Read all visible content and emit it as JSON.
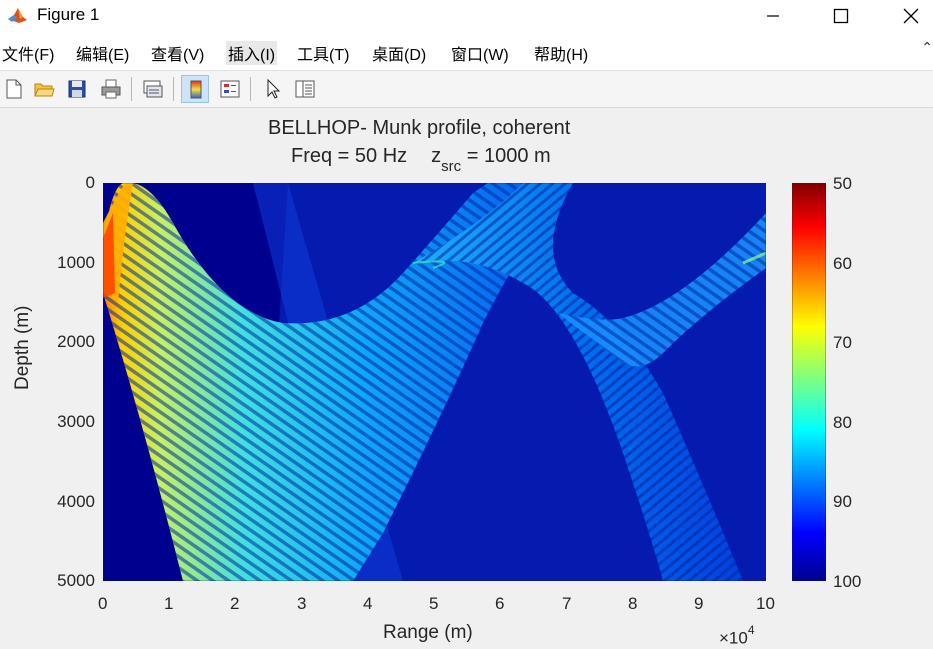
{
  "window": {
    "title": "Figure 1"
  },
  "menu": [
    "文件(F)",
    "编辑(E)",
    "查看(V)",
    "插入(I)",
    "工具(T)",
    "桌面(D)",
    "窗口(W)",
    "帮助(H)"
  ],
  "menu_overflow": "⌃",
  "toolbar": {
    "buttons": [
      "new-figure",
      "open-file",
      "save-figure",
      "print-figure",
      "link-plot",
      "toggle-plot-tools",
      "insert-legend",
      "edit-plot",
      "open-property-inspector"
    ]
  },
  "plot": {
    "title_line1": "BELLHOP- Munk profile, coherent",
    "title_line2_part1": "Freq = 50 Hz",
    "title_line2_z": "z",
    "title_line2_sub": "src",
    "title_line2_part2": " = 1000 m",
    "xlabel": "Range (m)",
    "ylabel": "Depth (m)",
    "x_exponent_base": "×10",
    "x_exponent_power": "4",
    "x_ticks": [
      "0",
      "1",
      "2",
      "3",
      "4",
      "5",
      "6",
      "7",
      "8",
      "9",
      "10"
    ],
    "y_ticks": [
      "0",
      "1000",
      "2000",
      "3000",
      "4000",
      "5000"
    ],
    "colorbar_ticks": [
      "50",
      "60",
      "70",
      "80",
      "90",
      "100"
    ],
    "colormap": "jet",
    "colorbar_direction": "reversed",
    "y_axis": "reversed"
  },
  "chart_data": {
    "type": "heatmap",
    "title": "BELLHOP- Munk profile, coherent; Freq = 50 Hz, z_src = 1000 m",
    "xlabel": "Range (m)",
    "ylabel": "Depth (m)",
    "xlim": [
      0,
      100000
    ],
    "ylim": [
      0,
      5000
    ],
    "y_reversed": true,
    "clim": [
      50,
      100
    ],
    "colormap": "jet (reversed)",
    "quantity": "transmission loss"
  },
  "colors": {
    "background": "#f0f0f0",
    "plot_background": "#00008f",
    "text": "#262626"
  }
}
